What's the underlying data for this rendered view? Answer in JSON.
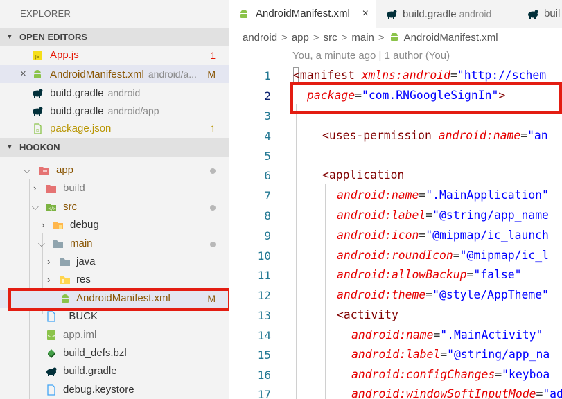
{
  "explorer": {
    "title": "EXPLORER",
    "open_editors_header": "OPEN EDITORS",
    "hookon_header": "HOOKON",
    "open_editors": [
      {
        "name": "App.js",
        "desc": "",
        "badge": "1"
      },
      {
        "name": "AndroidManifest.xml",
        "desc": "android/a...",
        "badge": "M"
      },
      {
        "name": "build.gradle",
        "desc": "android",
        "badge": ""
      },
      {
        "name": "build.gradle",
        "desc": "android/app",
        "badge": ""
      },
      {
        "name": "package.json",
        "desc": "",
        "badge": "1"
      }
    ],
    "close_glyph": "×",
    "tree": [
      {
        "name": "app"
      },
      {
        "name": "build"
      },
      {
        "name": "src"
      },
      {
        "name": "debug"
      },
      {
        "name": "main"
      },
      {
        "name": "java"
      },
      {
        "name": "res"
      },
      {
        "name": "AndroidManifest.xml",
        "badge": "M"
      },
      {
        "name": "_BUCK"
      },
      {
        "name": "app.iml"
      },
      {
        "name": "build_defs.bzl"
      },
      {
        "name": "build.gradle"
      },
      {
        "name": "debug.keystore"
      }
    ]
  },
  "tabs": [
    {
      "label": "AndroidManifest.xml",
      "desc": "",
      "close": "×"
    },
    {
      "label": "build.gradle",
      "desc": "android"
    },
    {
      "label": "buil",
      "desc": ""
    }
  ],
  "breadcrumb": [
    "android",
    "app",
    "src",
    "main",
    "AndroidManifest.xml"
  ],
  "breadcrumb_sep": ">",
  "blame": "You, a minute ago | 1 author (You)",
  "code": {
    "line_numbers": [
      "1",
      "2",
      "3",
      "4",
      "5",
      "6",
      "7",
      "8",
      "9",
      "10",
      "11",
      "12",
      "13",
      "14",
      "15",
      "16",
      "17"
    ],
    "l1": {
      "tag": "<manifest",
      "attr": "xmlns:android",
      "eq": "=",
      "val": "\"http://schem"
    },
    "l2": {
      "attr": "package",
      "eq": "=",
      "val": "\"com.RNGoogleSignIn\"",
      "close": ">"
    },
    "l4": {
      "tag": "<uses-permission",
      "attr": "android:name",
      "eq": "=",
      "val": "\"an"
    },
    "l6": {
      "tag": "<application"
    },
    "l7": {
      "attr": "android:name",
      "eq": "=",
      "val": "\".MainApplication\""
    },
    "l8": {
      "attr": "android:label",
      "eq": "=",
      "val": "\"@string/app_name"
    },
    "l9": {
      "attr": "android:icon",
      "eq": "=",
      "val": "\"@mipmap/ic_launch"
    },
    "l10": {
      "attr": "android:roundIcon",
      "eq": "=",
      "val": "\"@mipmap/ic_l"
    },
    "l11": {
      "attr": "android:allowBackup",
      "eq": "=",
      "val": "\"false\""
    },
    "l12": {
      "attr": "android:theme",
      "eq": "=",
      "val": "\"@style/AppTheme\""
    },
    "l13": {
      "tag": "<activity"
    },
    "l14": {
      "attr": "android:name",
      "eq": "=",
      "val": "\".MainActivity\""
    },
    "l15": {
      "attr": "android:label",
      "eq": "=",
      "val": "\"@string/app_na"
    },
    "l16": {
      "attr": "android:configChanges",
      "eq": "=",
      "val": "\"keyboa"
    },
    "l17": {
      "attr": "android:windowSoftInputMode",
      "eq": "=",
      "val": "\"ad"
    }
  },
  "colors": {
    "annotation": "#e31d12",
    "android_green": "#8bc34a",
    "gradle_teal": "#02303a"
  }
}
